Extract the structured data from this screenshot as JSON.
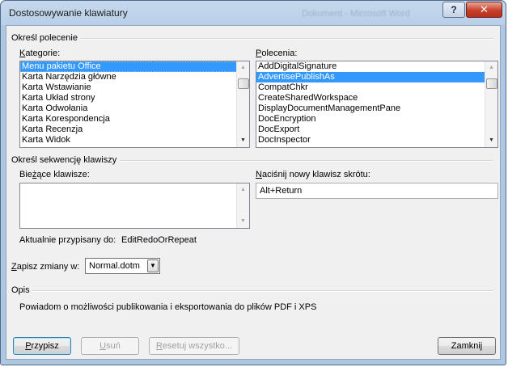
{
  "window": {
    "title": "Dostosowywanie klawiatury",
    "background_title": "Dokument - Microsoft Word",
    "help_label": "?",
    "close_label": "✕"
  },
  "command_group": {
    "title": "Określ polecenie",
    "categories_label": "Kategorie:",
    "categories": [
      "Menu pakietu Office",
      "Karta Narzędzia główne",
      "Karta Wstawianie",
      "Karta Układ strony",
      "Karta Odwołania",
      "Karta Korespondencja",
      "Karta Recenzja",
      "Karta Widok"
    ],
    "selected_category": "Menu pakietu Office",
    "commands_label": "Polecenia:",
    "commands": [
      "AddDigitalSignature",
      "AdvertisePublishAs",
      "CompatChkr",
      "CreateSharedWorkspace",
      "DisplayDocumentManagementPane",
      "DocEncryption",
      "DocExport",
      "DocInspector"
    ],
    "selected_command": "AdvertisePublishAs"
  },
  "keys_group": {
    "title": "Określ sekwencję klawiszy",
    "current_keys_label": "Bieżące klawisze:",
    "current_keys": [],
    "new_key_label": "Naciśnij nowy klawisz skrótu:",
    "new_key_value": "Alt+Return",
    "assigned_label": "Aktualnie przypisany do:",
    "assigned_value": "EditRedoOrRepeat"
  },
  "save": {
    "label": "Zapisz zmiany w:",
    "value": "Normal.dotm"
  },
  "description": {
    "title": "Opis",
    "text": "Powiadom o możliwości publikowania i eksportowania do plików PDF i XPS"
  },
  "buttons": {
    "assign": "Przypisz",
    "remove": "Usuń",
    "reset_all": "Resetuj wszystko...",
    "close": "Zamknij"
  }
}
